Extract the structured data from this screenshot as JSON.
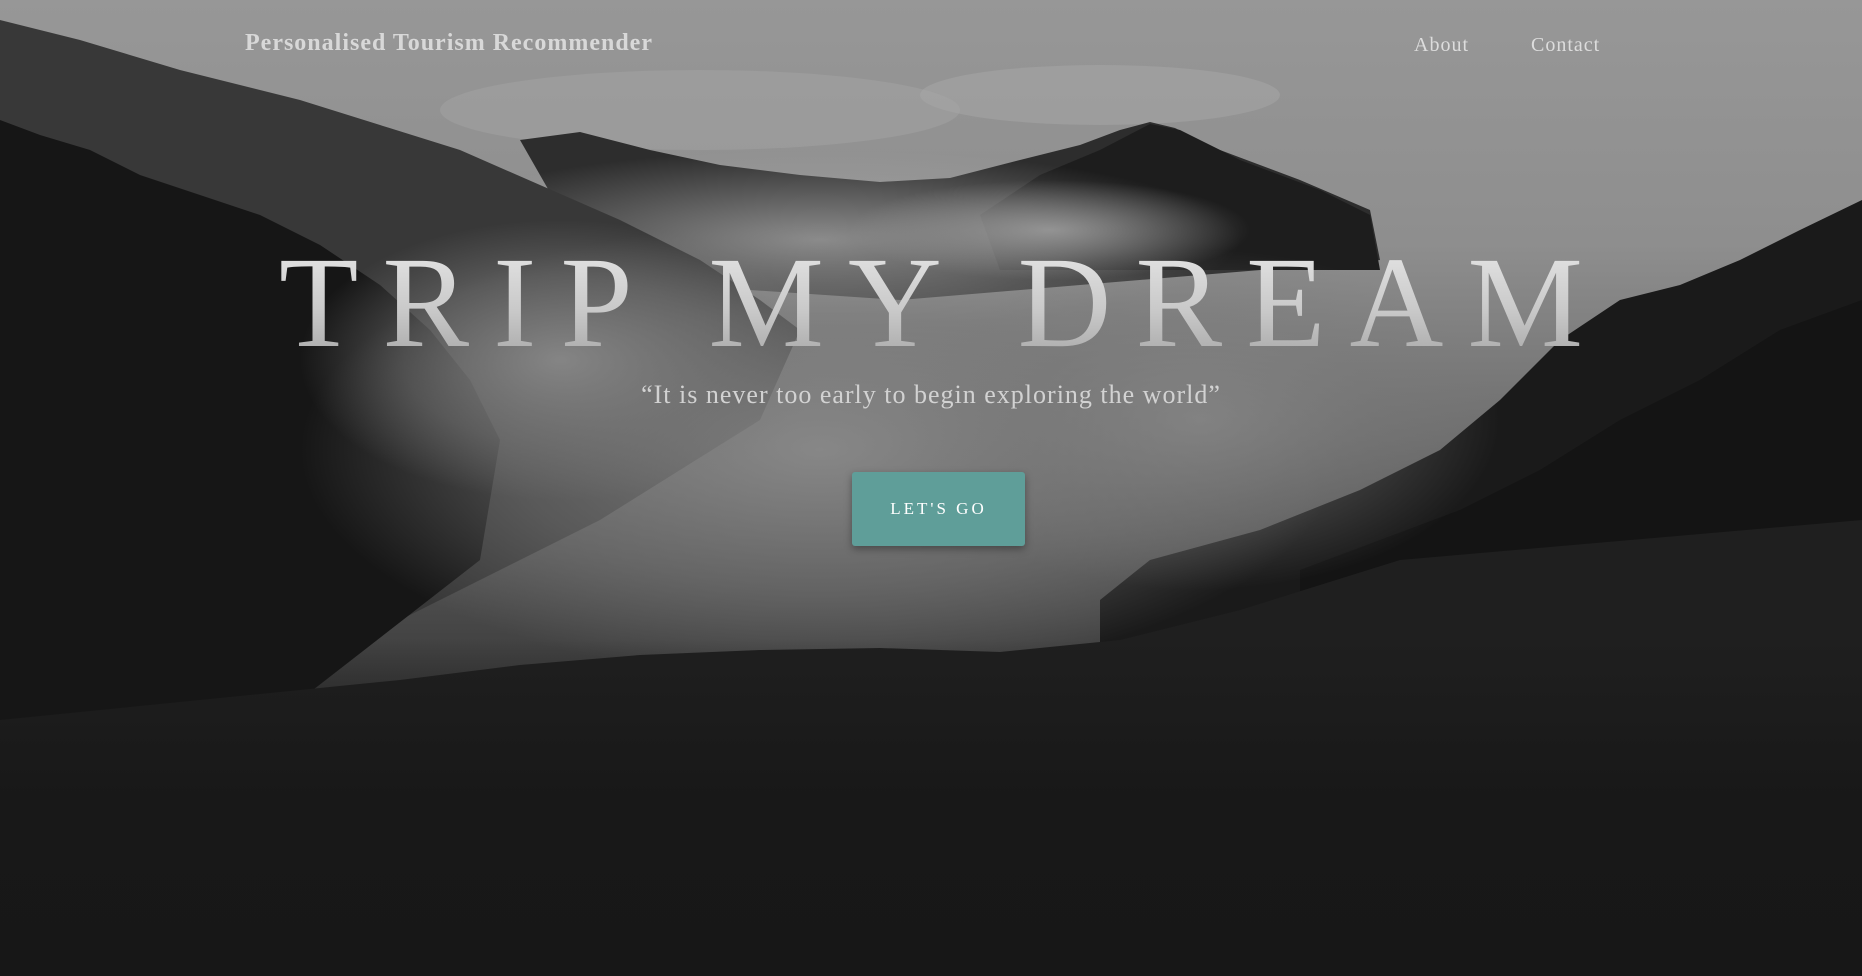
{
  "navbar": {
    "brand": "Personalised Tourism Recommender",
    "links": [
      {
        "label": "About"
      },
      {
        "label": "Contact"
      }
    ]
  },
  "hero": {
    "title": "TRIP MY DREAM",
    "quote": "“It is never too early to begin exploring the world”",
    "button_label": "LET'S GO"
  },
  "colors": {
    "accent": "#5f9e99",
    "background_dark": "#171717",
    "sky": "#9a9a9a"
  },
  "background": {
    "image": "misty-mountain-forest-landscape"
  }
}
